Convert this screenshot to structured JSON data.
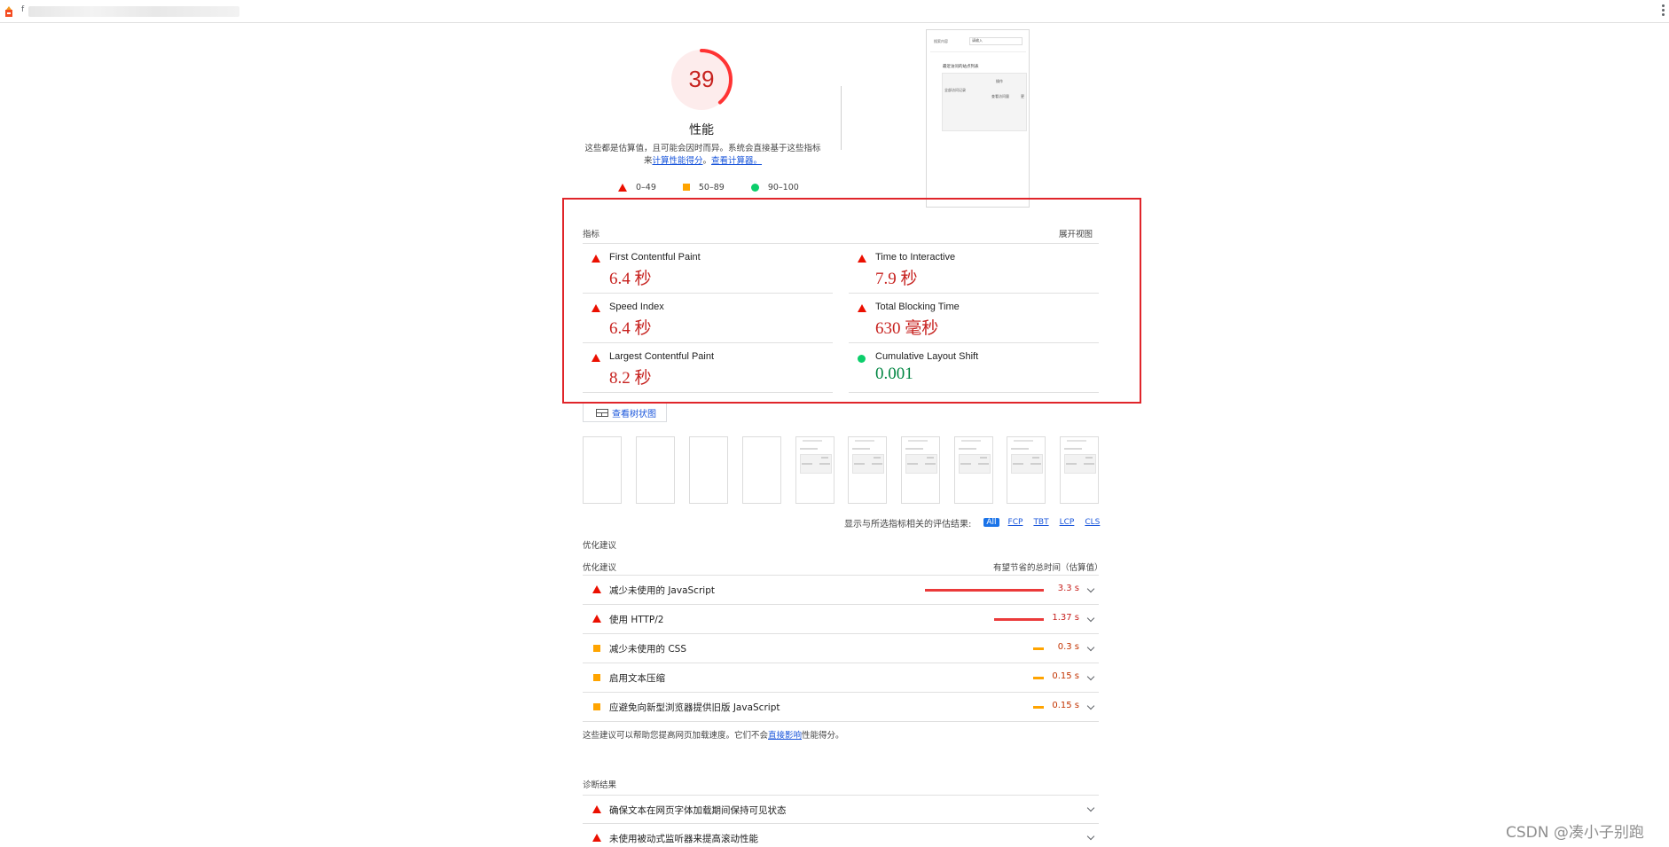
{
  "browser": {
    "url_prefix": "f",
    "favicon": "lighthouse-icon",
    "menu_icon": "more-vert-icon"
  },
  "colors": {
    "fail": "#eb0f00",
    "fail_text": "#c7221f",
    "average": "#ffa400",
    "pass": "#0cce6b",
    "pass_text": "#018642",
    "highlight_box": "#e0252a",
    "link": "#1a56db"
  },
  "gauge": {
    "score": "39",
    "score_fraction": 0.39,
    "title": "性能",
    "desc_prefix": "这些都是估算值，且可能会因时而异。系统会直接基于这些指标来",
    "desc_link1": "计算性能得分",
    "desc_mid": "。",
    "desc_link2": "查看计算器。"
  },
  "legend": {
    "fail": "0–49",
    "average": "50–89",
    "pass": "90–100"
  },
  "final_screenshot": {
    "label": "搜索内容",
    "input": "请输入",
    "title": "最近访问的站点列表",
    "col_a": "操作",
    "row_b": "全部访问记录",
    "cell_c": "查看访问量",
    "cell_d": "更"
  },
  "metrics": {
    "header": "指标",
    "toggle": "展开视图",
    "items": [
      {
        "title": "First Contentful Paint",
        "value": "6.4 秒",
        "rating": "fail"
      },
      {
        "title": "Time to Interactive",
        "value": "7.9 秒",
        "rating": "fail"
      },
      {
        "title": "Speed Index",
        "value": "6.4 秒",
        "rating": "fail"
      },
      {
        "title": "Total Blocking Time",
        "value": "630 毫秒",
        "rating": "fail"
      },
      {
        "title": "Largest Contentful Paint",
        "value": "8.2 秒",
        "rating": "fail"
      },
      {
        "title": "Cumulative Layout Shift",
        "value": "0.001",
        "rating": "pass"
      }
    ]
  },
  "treemap_button": "查看树状图",
  "filter": {
    "label": "显示与所选指标相关的评估结果:",
    "chips": [
      "All",
      "FCP",
      "TBT",
      "LCP",
      "CLS"
    ],
    "active": "All"
  },
  "opportunities": {
    "group_title": "优化建议",
    "column_left": "优化建议",
    "column_right": "有望节省的总时间（估算值）",
    "items": [
      {
        "title": "减少未使用的 JavaScript",
        "saving": "3.3 s",
        "saving_seconds": 3.3,
        "rating": "fail"
      },
      {
        "title": "使用 HTTP/2",
        "saving": "1.37 s",
        "saving_seconds": 1.37,
        "rating": "fail"
      },
      {
        "title": "减少未使用的 CSS",
        "saving": "0.3 s",
        "saving_seconds": 0.3,
        "rating": "average"
      },
      {
        "title": "启用文本压缩",
        "saving": "0.15 s",
        "saving_seconds": 0.15,
        "rating": "average"
      },
      {
        "title": "应避免向新型浏览器提供旧版 JavaScript",
        "saving": "0.15 s",
        "saving_seconds": 0.15,
        "rating": "average"
      }
    ],
    "footer_prefix": "这些建议可以帮助您提高网页加载速度。它们不会",
    "footer_link": "直接影响",
    "footer_suffix": "性能得分。"
  },
  "diagnostics": {
    "title": "诊断结果",
    "items": [
      {
        "title": "确保文本在网页字体加载期间保持可见状态",
        "rating": "fail"
      },
      {
        "title": "未使用被动式监听器来提高滚动性能",
        "rating": "fail"
      }
    ]
  },
  "watermark": "CSDN @凑小子别跑"
}
